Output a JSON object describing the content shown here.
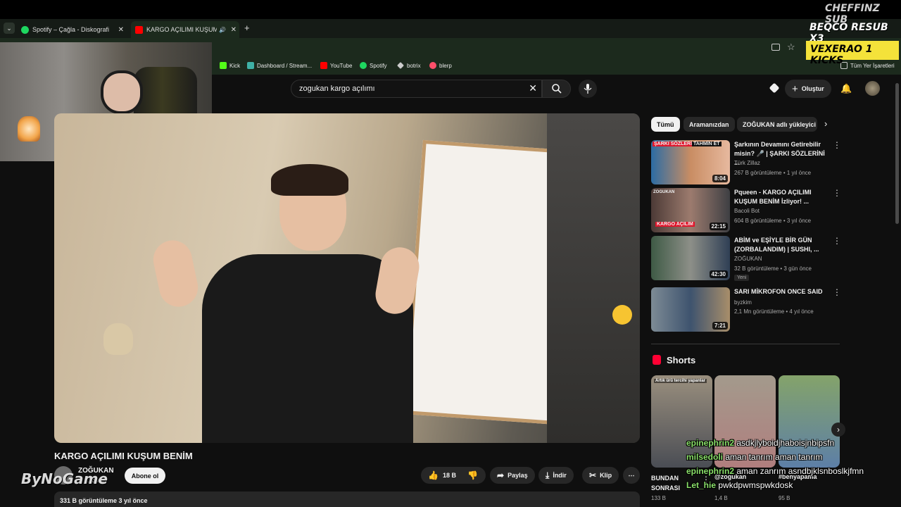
{
  "overlay": {
    "line1": "CHEFFINZ  SUB",
    "line2": "BEQCO  RESUB X3",
    "line3": "VEXERAO  1 KICKS",
    "watermark": "ByNoGame"
  },
  "tabs": [
    {
      "label": "Spotify – Çağla - Diskografi",
      "color": "#1ed760"
    },
    {
      "label": "KARGO AÇILIMI KUŞUM BE",
      "color": "#ff0000"
    }
  ],
  "bookmarks": [
    {
      "label": "Kick",
      "color": "#53fc18"
    },
    {
      "label": "Dashboard / Stream...",
      "color": "#3fb1a6"
    },
    {
      "label": "YouTube",
      "color": "#ff0000"
    },
    {
      "label": "Spotify",
      "color": "#1ed760"
    },
    {
      "label": "botrix",
      "color": "#cccccc"
    },
    {
      "label": "blerp",
      "color": "#ff4f6a"
    }
  ],
  "bookmarks_all": "Tüm Yer İşaretleri",
  "search": {
    "query": "zogukan kargo açılımı"
  },
  "header": {
    "create_label": "Oluştur"
  },
  "chips": [
    "Tümü",
    "Aramanızdan",
    "ZOĞUKAN adlı yükleyici"
  ],
  "video": {
    "title": "KARGO AÇILIMI KUŞUM BENİM",
    "channel": "ZOĞUKAN",
    "subscribers": "...bone",
    "subscribe_label": "Abone ol",
    "likes": "18 B",
    "share_label": "Paylaş",
    "download_label": "İndir",
    "clip_label": "Klip",
    "views_date": "331 B görüntüleme  3 yıl önce"
  },
  "recommendations": [
    {
      "title": "Şarkının Devamını Getirebilir misin? 🎤 | ŞARKI SÖZLERİNİ ...",
      "channel": "Türk Zillaz",
      "meta": "267 B görüntüleme • 1 yıl önce",
      "duration": "8:04",
      "badge": ""
    },
    {
      "title": "Pqueen - KARGO AÇILIMI KUŞUM BENİM İzliyor! ...",
      "channel": "Bacoli Bot",
      "meta": "604 B görüntüleme • 3 yıl önce",
      "duration": "22:15",
      "badge": ""
    },
    {
      "title": "ABİM ve EŞİYLE BİR GÜN (ZORBALANDIM) | SUSHI, ...",
      "channel": "ZOĞUKAN",
      "meta": "32 B görüntüleme • 3 gün önce",
      "duration": "42:30",
      "badge": "Yeni"
    },
    {
      "title": "SARI MİKROFON ONCE SAID",
      "channel": "byzkim",
      "meta": "2,1 Mn görüntüleme • 4 yıl önce",
      "duration": "7:21",
      "badge": ""
    }
  ],
  "thumb_text": {
    "r1a": "ŞARKI SÖZLERİNİ",
    "r1b": "TAHMİN ET",
    "r2a": "ZOGUKAN",
    "r2b": "KARGO AÇILIM"
  },
  "shorts": {
    "heading": "Shorts",
    "items": [
      {
        "caption": "Artık ürü tercihi yapanlar",
        "title": "BUNDAN SONRASI",
        "views": "133 B"
      },
      {
        "caption": "",
        "title": "@zogukan",
        "views": "1,4 B"
      },
      {
        "caption": "",
        "title": "#benyapama",
        "views": "95 B"
      }
    ]
  },
  "chat": [
    {
      "user": "epinephrin2",
      "msg": "asdkjlyboidjhaboisjnbipsfn"
    },
    {
      "user": "milsedoli",
      "msg": "aman tanrım aman tanrım"
    },
    {
      "user": "epinephrin2",
      "msg": "aman zanrım asndbjklsnboslkjfmn"
    },
    {
      "user": "Let_hie",
      "msg": "pwkdpwmspwkdosk"
    }
  ]
}
